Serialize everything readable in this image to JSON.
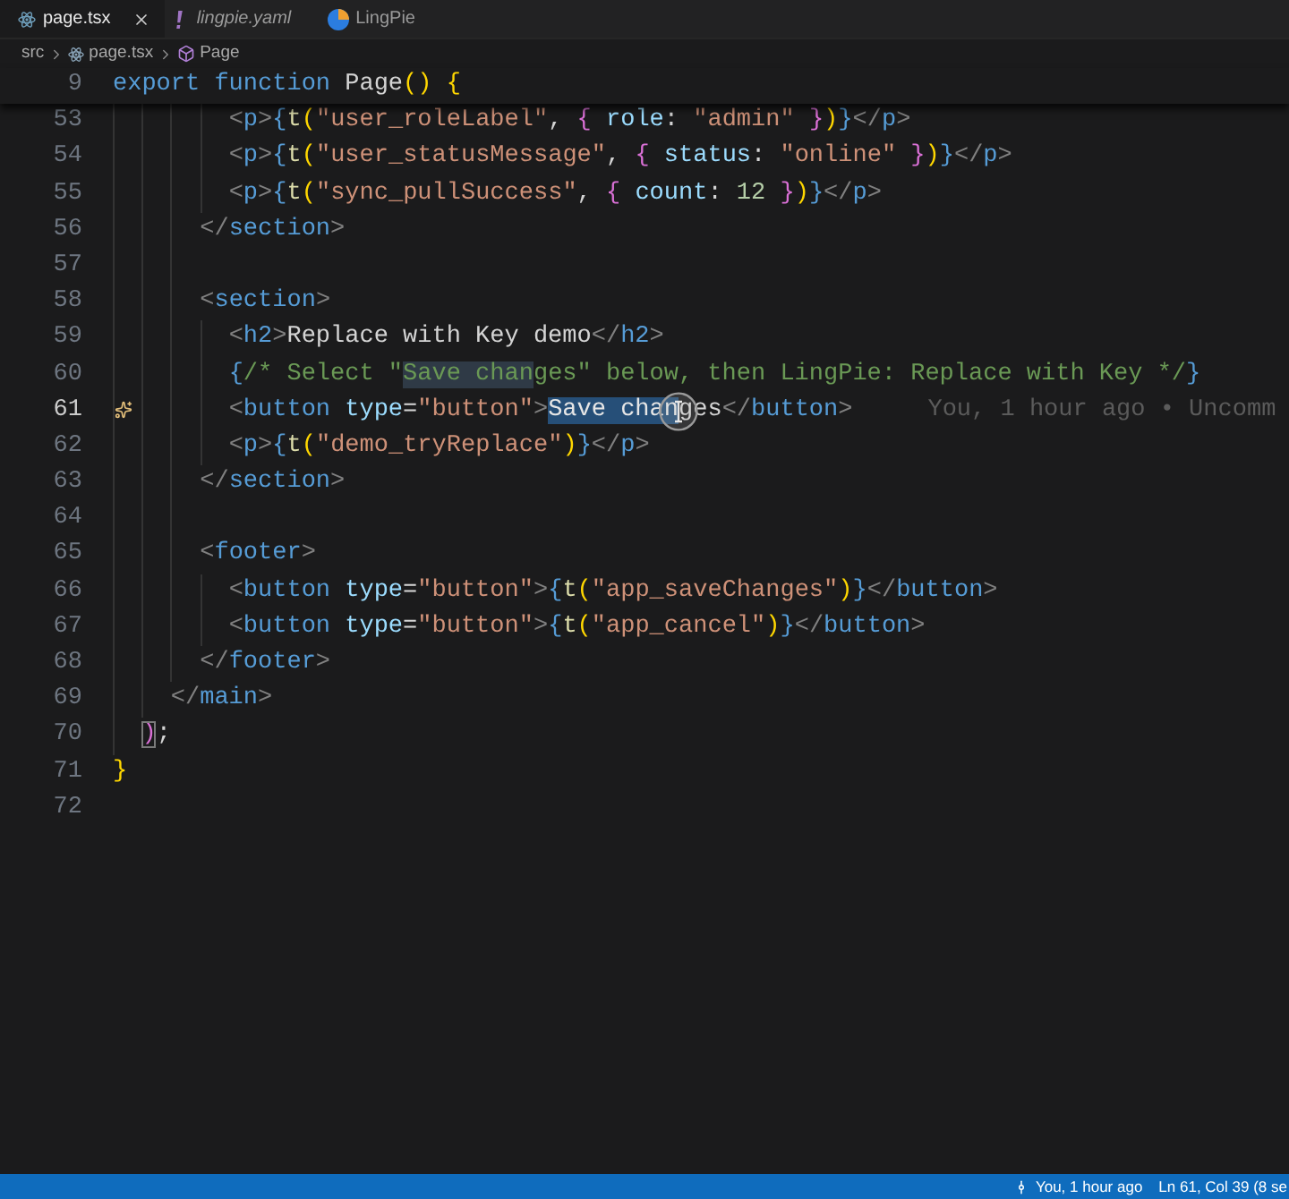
{
  "tabs": [
    {
      "label": "page.tsx",
      "kind": "tsx",
      "selected": true,
      "preview": false
    },
    {
      "label": "lingpie.yaml",
      "kind": "yaml",
      "selected": false,
      "preview": true
    },
    {
      "label": "LingPie",
      "kind": "webview",
      "selected": false,
      "preview": false
    }
  ],
  "breadcrumb": [
    {
      "label": "src",
      "kind": "folder"
    },
    {
      "label": "page.tsx",
      "kind": "tsx"
    },
    {
      "label": "Page",
      "kind": "symbol"
    }
  ],
  "sticky_line": {
    "number": "9",
    "tokens": [
      {
        "text": "export",
        "kind": "keyword"
      },
      {
        "text": " function",
        "kind": "keyword"
      },
      {
        "text": " Page",
        "kind": "plain"
      },
      {
        "text": "()",
        "kind": "b1"
      },
      {
        "text": " {",
        "kind": "b1"
      }
    ]
  },
  "lines": [
    {
      "number": "53",
      "active": false,
      "gutter_action": false,
      "tokens": [
        {
          "text": "        <",
          "kind": "punct"
        },
        {
          "text": "p",
          "kind": "tag"
        },
        {
          "text": ">",
          "kind": "punct"
        },
        {
          "text": "{",
          "kind": "jsx"
        },
        {
          "text": "t",
          "kind": "func"
        },
        {
          "text": "(",
          "kind": "b1"
        },
        {
          "text": "\"user_roleLabel\"",
          "kind": "string"
        },
        {
          "text": ", ",
          "kind": "plain"
        },
        {
          "text": "{",
          "kind": "b2"
        },
        {
          "text": " role",
          "kind": "attr"
        },
        {
          "text": ": ",
          "kind": "plain"
        },
        {
          "text": "\"admin\"",
          "kind": "string"
        },
        {
          "text": " }",
          "kind": "b2"
        },
        {
          "text": ")",
          "kind": "b1"
        },
        {
          "text": "}",
          "kind": "jsx"
        },
        {
          "text": "</",
          "kind": "punct"
        },
        {
          "text": "p",
          "kind": "tag"
        },
        {
          "text": ">",
          "kind": "punct"
        }
      ]
    },
    {
      "number": "54",
      "active": false,
      "gutter_action": false,
      "tokens": [
        {
          "text": "        <",
          "kind": "punct"
        },
        {
          "text": "p",
          "kind": "tag"
        },
        {
          "text": ">",
          "kind": "punct"
        },
        {
          "text": "{",
          "kind": "jsx"
        },
        {
          "text": "t",
          "kind": "func"
        },
        {
          "text": "(",
          "kind": "b1"
        },
        {
          "text": "\"user_statusMessage\"",
          "kind": "string"
        },
        {
          "text": ", ",
          "kind": "plain"
        },
        {
          "text": "{",
          "kind": "b2"
        },
        {
          "text": " status",
          "kind": "attr"
        },
        {
          "text": ": ",
          "kind": "plain"
        },
        {
          "text": "\"online\"",
          "kind": "string"
        },
        {
          "text": " }",
          "kind": "b2"
        },
        {
          "text": ")",
          "kind": "b1"
        },
        {
          "text": "}",
          "kind": "jsx"
        },
        {
          "text": "</",
          "kind": "punct"
        },
        {
          "text": "p",
          "kind": "tag"
        },
        {
          "text": ">",
          "kind": "punct"
        }
      ]
    },
    {
      "number": "55",
      "active": false,
      "gutter_action": false,
      "tokens": [
        {
          "text": "        <",
          "kind": "punct"
        },
        {
          "text": "p",
          "kind": "tag"
        },
        {
          "text": ">",
          "kind": "punct"
        },
        {
          "text": "{",
          "kind": "jsx"
        },
        {
          "text": "t",
          "kind": "func"
        },
        {
          "text": "(",
          "kind": "b1"
        },
        {
          "text": "\"sync_pullSuccess\"",
          "kind": "string"
        },
        {
          "text": ", ",
          "kind": "plain"
        },
        {
          "text": "{",
          "kind": "b2"
        },
        {
          "text": " count",
          "kind": "attr"
        },
        {
          "text": ": ",
          "kind": "plain"
        },
        {
          "text": "12",
          "kind": "number"
        },
        {
          "text": " }",
          "kind": "b2"
        },
        {
          "text": ")",
          "kind": "b1"
        },
        {
          "text": "}",
          "kind": "jsx"
        },
        {
          "text": "</",
          "kind": "punct"
        },
        {
          "text": "p",
          "kind": "tag"
        },
        {
          "text": ">",
          "kind": "punct"
        }
      ]
    },
    {
      "number": "56",
      "active": false,
      "gutter_action": false,
      "tokens": [
        {
          "text": "      </",
          "kind": "punct"
        },
        {
          "text": "section",
          "kind": "tag"
        },
        {
          "text": ">",
          "kind": "punct"
        }
      ]
    },
    {
      "number": "57",
      "active": false,
      "gutter_action": false
    },
    {
      "number": "58",
      "active": false,
      "gutter_action": false,
      "tokens": [
        {
          "text": "      <",
          "kind": "punct"
        },
        {
          "text": "section",
          "kind": "tag"
        },
        {
          "text": ">",
          "kind": "punct"
        }
      ]
    },
    {
      "number": "59",
      "active": false,
      "gutter_action": false,
      "tokens": [
        {
          "text": "        <",
          "kind": "punct"
        },
        {
          "text": "h2",
          "kind": "tag"
        },
        {
          "text": ">",
          "kind": "punct"
        },
        {
          "text": "Replace with Key demo",
          "kind": "plain"
        },
        {
          "text": "</",
          "kind": "punct"
        },
        {
          "text": "h2",
          "kind": "tag"
        },
        {
          "text": ">",
          "kind": "punct"
        }
      ]
    },
    {
      "number": "60",
      "active": false,
      "gutter_action": false,
      "tokens": [
        {
          "text": "        {",
          "kind": "jsx"
        },
        {
          "text": "/* Select \"",
          "kind": "comment"
        },
        {
          "text": "Save chan",
          "kind": "occurrence"
        },
        {
          "text": "ges\" below, then LingPie: Replace with Key */",
          "kind": "comment"
        },
        {
          "text": "}",
          "kind": "jsx"
        }
      ]
    },
    {
      "number": "61",
      "active": true,
      "gutter_action": true,
      "tokens": [
        {
          "text": "        <",
          "kind": "punct"
        },
        {
          "text": "button",
          "kind": "tag"
        },
        {
          "text": " type",
          "kind": "attr"
        },
        {
          "text": "=",
          "kind": "plain"
        },
        {
          "text": "\"button\"",
          "kind": "string"
        },
        {
          "text": ">",
          "kind": "punct"
        },
        {
          "text": "Save chan",
          "kind": "selection"
        },
        {
          "text": "ges",
          "kind": "plain"
        },
        {
          "text": "</",
          "kind": "punct"
        },
        {
          "text": "button",
          "kind": "tag"
        },
        {
          "text": ">",
          "kind": "punct"
        }
      ],
      "blame": "You, 1 hour ago • Uncomm"
    },
    {
      "number": "62",
      "active": false,
      "gutter_action": false,
      "tokens": [
        {
          "text": "        <",
          "kind": "punct"
        },
        {
          "text": "p",
          "kind": "tag"
        },
        {
          "text": ">",
          "kind": "punct"
        },
        {
          "text": "{",
          "kind": "jsx"
        },
        {
          "text": "t",
          "kind": "func"
        },
        {
          "text": "(",
          "kind": "b1"
        },
        {
          "text": "\"demo_tryReplace\"",
          "kind": "string"
        },
        {
          "text": ")",
          "kind": "b1"
        },
        {
          "text": "}",
          "kind": "jsx"
        },
        {
          "text": "</",
          "kind": "punct"
        },
        {
          "text": "p",
          "kind": "tag"
        },
        {
          "text": ">",
          "kind": "punct"
        }
      ]
    },
    {
      "number": "63",
      "active": false,
      "gutter_action": false,
      "tokens": [
        {
          "text": "      </",
          "kind": "punct"
        },
        {
          "text": "section",
          "kind": "tag"
        },
        {
          "text": ">",
          "kind": "punct"
        }
      ]
    },
    {
      "number": "64",
      "active": false,
      "gutter_action": false
    },
    {
      "number": "65",
      "active": false,
      "gutter_action": false,
      "tokens": [
        {
          "text": "      <",
          "kind": "punct"
        },
        {
          "text": "footer",
          "kind": "tag"
        },
        {
          "text": ">",
          "kind": "punct"
        }
      ]
    },
    {
      "number": "66",
      "active": false,
      "gutter_action": false,
      "tokens": [
        {
          "text": "        <",
          "kind": "punct"
        },
        {
          "text": "button",
          "kind": "tag"
        },
        {
          "text": " type",
          "kind": "attr"
        },
        {
          "text": "=",
          "kind": "plain"
        },
        {
          "text": "\"button\"",
          "kind": "string"
        },
        {
          "text": ">",
          "kind": "punct"
        },
        {
          "text": "{",
          "kind": "jsx"
        },
        {
          "text": "t",
          "kind": "func"
        },
        {
          "text": "(",
          "kind": "b1"
        },
        {
          "text": "\"app_saveChanges\"",
          "kind": "string"
        },
        {
          "text": ")",
          "kind": "b1"
        },
        {
          "text": "}",
          "kind": "jsx"
        },
        {
          "text": "</",
          "kind": "punct"
        },
        {
          "text": "button",
          "kind": "tag"
        },
        {
          "text": ">",
          "kind": "punct"
        }
      ]
    },
    {
      "number": "67",
      "active": false,
      "gutter_action": false,
      "tokens": [
        {
          "text": "        <",
          "kind": "punct"
        },
        {
          "text": "button",
          "kind": "tag"
        },
        {
          "text": " type",
          "kind": "attr"
        },
        {
          "text": "=",
          "kind": "plain"
        },
        {
          "text": "\"button\"",
          "kind": "string"
        },
        {
          "text": ">",
          "kind": "punct"
        },
        {
          "text": "{",
          "kind": "jsx"
        },
        {
          "text": "t",
          "kind": "func"
        },
        {
          "text": "(",
          "kind": "b1"
        },
        {
          "text": "\"app_cancel\"",
          "kind": "string"
        },
        {
          "text": ")",
          "kind": "b1"
        },
        {
          "text": "}",
          "kind": "jsx"
        },
        {
          "text": "</",
          "kind": "punct"
        },
        {
          "text": "button",
          "kind": "tag"
        },
        {
          "text": ">",
          "kind": "punct"
        }
      ]
    },
    {
      "number": "68",
      "active": false,
      "gutter_action": false,
      "tokens": [
        {
          "text": "      </",
          "kind": "punct"
        },
        {
          "text": "footer",
          "kind": "tag"
        },
        {
          "text": ">",
          "kind": "punct"
        }
      ]
    },
    {
      "number": "69",
      "active": false,
      "gutter_action": false,
      "tokens": [
        {
          "text": "    </",
          "kind": "punct"
        },
        {
          "text": "main",
          "kind": "tag"
        },
        {
          "text": ">",
          "kind": "punct"
        }
      ]
    },
    {
      "number": "70",
      "active": false,
      "gutter_action": false,
      "tokens": [
        {
          "text": "  )",
          "kind": "match"
        },
        {
          "text": ";",
          "kind": "plain"
        }
      ]
    },
    {
      "number": "71",
      "active": false,
      "gutter_action": false,
      "tokens": [
        {
          "text": "}",
          "kind": "b1"
        }
      ]
    },
    {
      "number": "72",
      "active": false,
      "gutter_action": false
    }
  ],
  "status_bar": {
    "items": [
      {
        "kind": "blame",
        "label": "You, 1 hour ago"
      },
      {
        "kind": "cursor",
        "label": "Ln 61, Col 39 (8 se"
      }
    ]
  }
}
